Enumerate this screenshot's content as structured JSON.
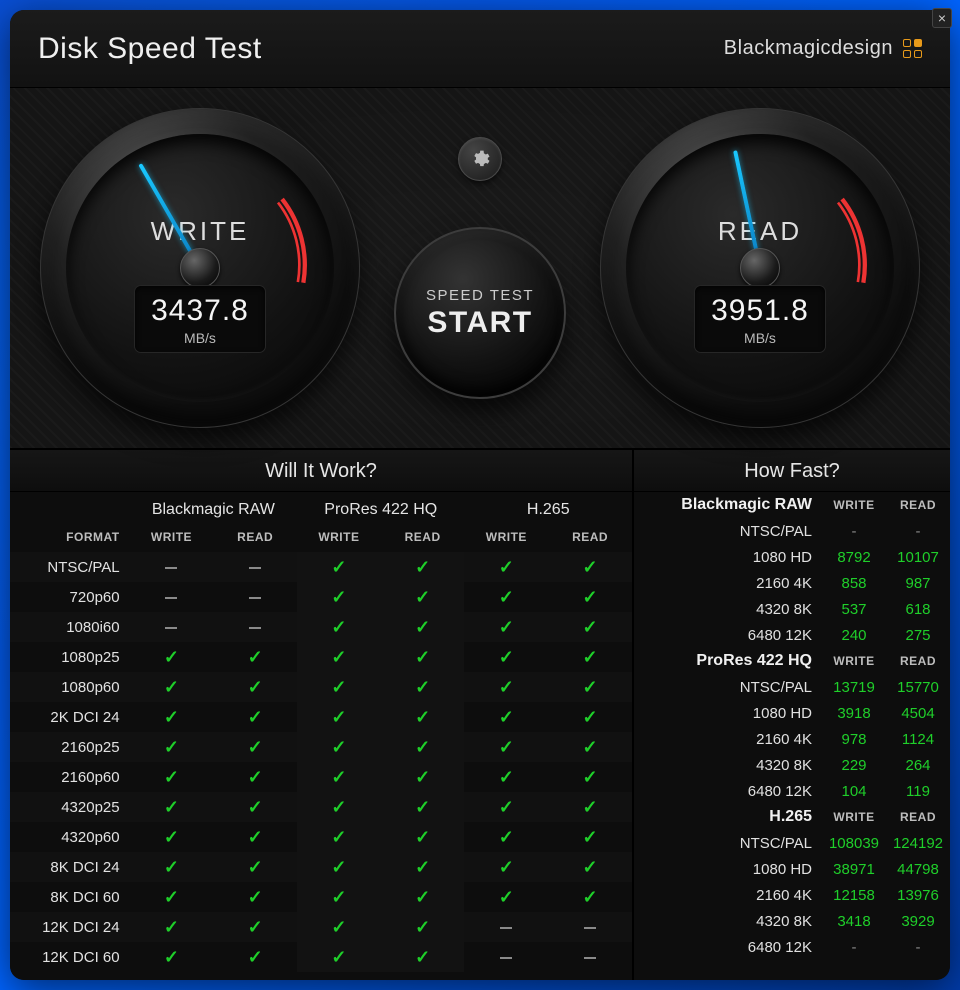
{
  "close": "×",
  "title": "Disk Speed Test",
  "brand": "Blackmagicdesign",
  "gauges": {
    "write": {
      "label": "WRITE",
      "value": "3437.8",
      "unit": "MB/s",
      "needle_deg": -30
    },
    "read": {
      "label": "READ",
      "value": "3951.8",
      "unit": "MB/s",
      "needle_deg": -12
    }
  },
  "start": {
    "line1": "SPEED TEST",
    "line2": "START"
  },
  "will_it_work": {
    "title": "Will It Work?",
    "format_header": "FORMAT",
    "codecs": [
      "Blackmagic RAW",
      "ProRes 422 HQ",
      "H.265"
    ],
    "sub": [
      "WRITE",
      "READ"
    ],
    "rows": [
      {
        "fmt": "NTSC/PAL",
        "cells": [
          "-",
          "-",
          "y",
          "y",
          "y",
          "y"
        ]
      },
      {
        "fmt": "720p60",
        "cells": [
          "-",
          "-",
          "y",
          "y",
          "y",
          "y"
        ]
      },
      {
        "fmt": "1080i60",
        "cells": [
          "-",
          "-",
          "y",
          "y",
          "y",
          "y"
        ]
      },
      {
        "fmt": "1080p25",
        "cells": [
          "y",
          "y",
          "y",
          "y",
          "y",
          "y"
        ]
      },
      {
        "fmt": "1080p60",
        "cells": [
          "y",
          "y",
          "y",
          "y",
          "y",
          "y"
        ]
      },
      {
        "fmt": "2K DCI 24",
        "cells": [
          "y",
          "y",
          "y",
          "y",
          "y",
          "y"
        ]
      },
      {
        "fmt": "2160p25",
        "cells": [
          "y",
          "y",
          "y",
          "y",
          "y",
          "y"
        ]
      },
      {
        "fmt": "2160p60",
        "cells": [
          "y",
          "y",
          "y",
          "y",
          "y",
          "y"
        ]
      },
      {
        "fmt": "4320p25",
        "cells": [
          "y",
          "y",
          "y",
          "y",
          "y",
          "y"
        ]
      },
      {
        "fmt": "4320p60",
        "cells": [
          "y",
          "y",
          "y",
          "y",
          "y",
          "y"
        ]
      },
      {
        "fmt": "8K DCI 24",
        "cells": [
          "y",
          "y",
          "y",
          "y",
          "y",
          "y"
        ]
      },
      {
        "fmt": "8K DCI 60",
        "cells": [
          "y",
          "y",
          "y",
          "y",
          "y",
          "y"
        ]
      },
      {
        "fmt": "12K DCI 24",
        "cells": [
          "y",
          "y",
          "y",
          "y",
          "-",
          "-"
        ]
      },
      {
        "fmt": "12K DCI 60",
        "cells": [
          "y",
          "y",
          "y",
          "y",
          "-",
          "-"
        ]
      }
    ]
  },
  "how_fast": {
    "title": "How Fast?",
    "sub": [
      "WRITE",
      "READ"
    ],
    "sections": [
      {
        "codec": "Blackmagic RAW",
        "rows": [
          {
            "fmt": "NTSC/PAL",
            "write": "-",
            "read": "-"
          },
          {
            "fmt": "1080 HD",
            "write": "8792",
            "read": "10107"
          },
          {
            "fmt": "2160 4K",
            "write": "858",
            "read": "987"
          },
          {
            "fmt": "4320 8K",
            "write": "537",
            "read": "618"
          },
          {
            "fmt": "6480 12K",
            "write": "240",
            "read": "275"
          }
        ]
      },
      {
        "codec": "ProRes 422 HQ",
        "rows": [
          {
            "fmt": "NTSC/PAL",
            "write": "13719",
            "read": "15770"
          },
          {
            "fmt": "1080 HD",
            "write": "3918",
            "read": "4504"
          },
          {
            "fmt": "2160 4K",
            "write": "978",
            "read": "1124"
          },
          {
            "fmt": "4320 8K",
            "write": "229",
            "read": "264"
          },
          {
            "fmt": "6480 12K",
            "write": "104",
            "read": "119"
          }
        ]
      },
      {
        "codec": "H.265",
        "rows": [
          {
            "fmt": "NTSC/PAL",
            "write": "108039",
            "read": "124192"
          },
          {
            "fmt": "1080 HD",
            "write": "38971",
            "read": "44798"
          },
          {
            "fmt": "2160 4K",
            "write": "12158",
            "read": "13976"
          },
          {
            "fmt": "4320 8K",
            "write": "3418",
            "read": "3929"
          },
          {
            "fmt": "6480 12K",
            "write": "-",
            "read": "-"
          }
        ]
      }
    ]
  }
}
